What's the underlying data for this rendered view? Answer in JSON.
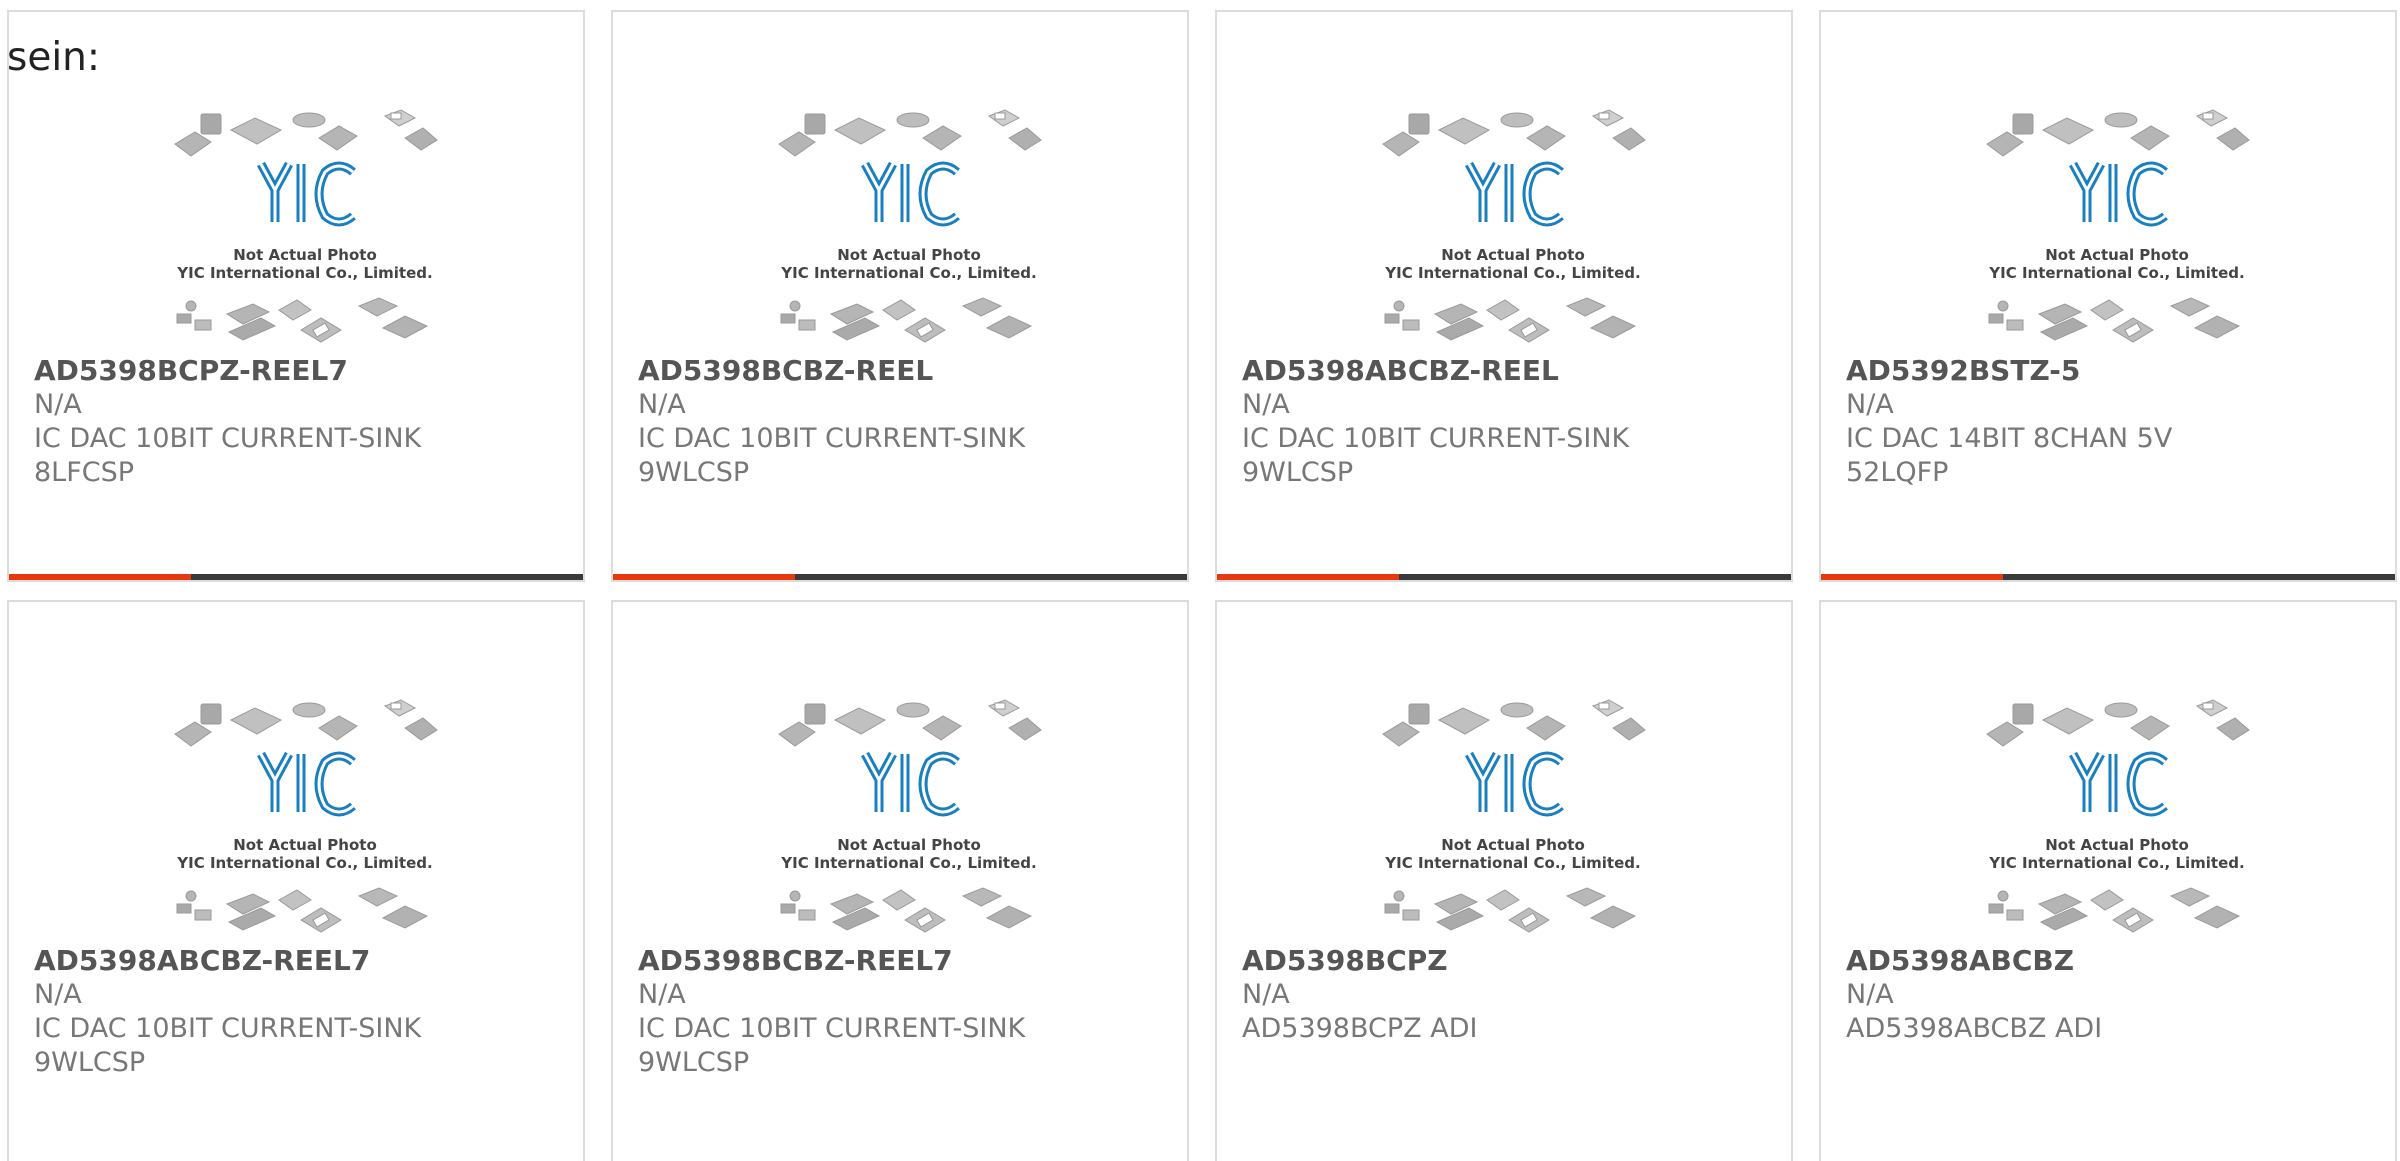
{
  "intro_text": "sein:",
  "colors": {
    "accent": "#e8380d",
    "bar": "#3a3a3a",
    "logo_blue": "#1a7fc1"
  },
  "placeholder": {
    "line1": "Not Actual Photo",
    "line2": "YIC International Co., Limited.",
    "logo": "YIC"
  },
  "products": [
    {
      "part": "AD5398BCPZ-REEL7",
      "status": "N/A",
      "desc": "IC DAC 10BIT CURRENT-SINK 8LFCSP",
      "accent_bar": true
    },
    {
      "part": "AD5398BCBZ-REEL",
      "status": "N/A",
      "desc": "IC DAC 10BIT CURRENT-SINK 9WLCSP",
      "accent_bar": true
    },
    {
      "part": "AD5398ABCBZ-REEL",
      "status": "N/A",
      "desc": "IC DAC 10BIT CURRENT-SINK 9WLCSP",
      "accent_bar": true
    },
    {
      "part": "AD5392BSTZ-5",
      "status": "N/A",
      "desc": "IC DAC 14BIT 8CHAN 5V 52LQFP",
      "accent_bar": true
    },
    {
      "part": "AD5398ABCBZ-REEL7",
      "status": "N/A",
      "desc": "IC DAC 10BIT CURRENT-SINK 9WLCSP",
      "accent_bar": false
    },
    {
      "part": "AD5398BCBZ-REEL7",
      "status": "N/A",
      "desc": "IC DAC 10BIT CURRENT-SINK 9WLCSP",
      "accent_bar": false
    },
    {
      "part": "AD5398BCPZ",
      "status": "N/A",
      "desc": "AD5398BCPZ ADI",
      "accent_bar": false
    },
    {
      "part": "AD5398ABCBZ",
      "status": "N/A",
      "desc": "AD5398ABCBZ ADI",
      "accent_bar": false
    }
  ]
}
